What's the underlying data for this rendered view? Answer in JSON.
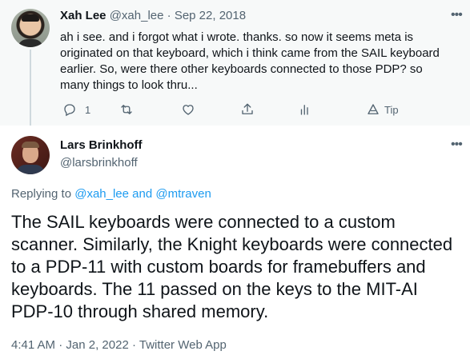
{
  "reply_tweet": {
    "author_name": "Xah Lee",
    "handle": "@xah_lee",
    "separator": "·",
    "date": "Sep 22, 2018",
    "text": "ah i see. and i forgot what i wrote. thanks. so now it seems meta is originated on that keyboard, which i think came from the SAIL keyboard earlier. So, were there other keyboards connected to those PDP? so many things to look thru...",
    "actions": {
      "reply_count": "1",
      "tip_label": "Tip"
    },
    "icons": [
      "more-icon",
      "reply-icon",
      "retweet-icon",
      "like-icon",
      "share-icon",
      "analytics-icon",
      "tip-icon"
    ]
  },
  "main_tweet": {
    "author_name": "Lars Brinkhoff",
    "handle": "@larsbrinkhoff",
    "replying_prefix": "Replying to",
    "mention_1": "@xah_lee",
    "conjunction": "and",
    "mention_2": "@mtraven",
    "text": "The SAIL keyboards were connected to a custom scanner.  Similarly, the Knight keyboards were connected to a PDP-11 with custom boards for framebuffers and keyboards.  The 11 passed on the keys to the MIT-AI PDP-10 through shared memory.",
    "time": "4:41 AM",
    "separator": "·",
    "date": "Jan 2, 2022",
    "source": "Twitter Web App"
  },
  "colors": {
    "text": "#0f1419",
    "muted": "#536471",
    "link": "#1d9bf0",
    "reply_background": "#f7f9f9",
    "thread_line": "#cfd9de"
  }
}
